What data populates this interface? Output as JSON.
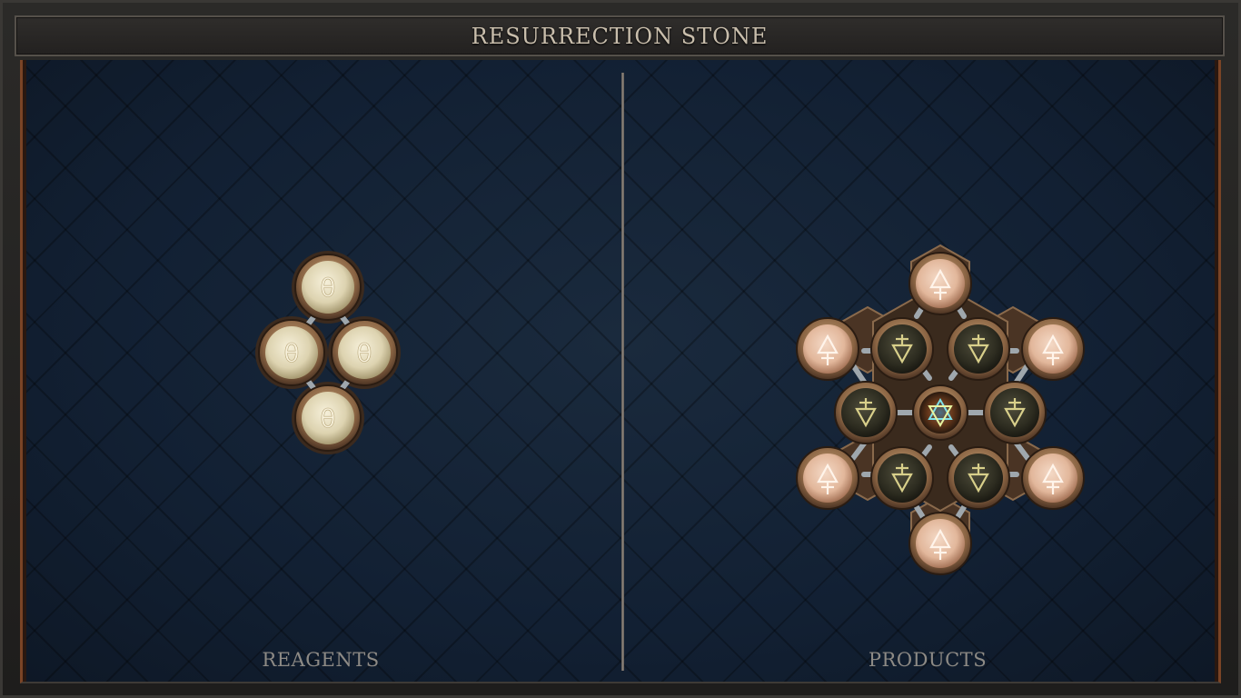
{
  "window": {
    "title": "RESURRECTION STONE"
  },
  "reagents": {
    "label": "REAGENTS",
    "node_symbol": "θ",
    "node_count": 4
  },
  "products": {
    "label": "PRODUCTS",
    "outer_symbol": "fire-elemental-rune",
    "inner_symbol": "earth-elemental-rune",
    "center_symbol": "hexagram-star",
    "outer_node_count": 6,
    "inner_node_count": 6,
    "center_node_count": 1
  },
  "colors": {
    "frame": "#2b2a28",
    "panel_background": "#142030",
    "accent_copper": "#7a4426",
    "title_text": "#c9beac",
    "label_text": "#8d8a85",
    "reagent_orb": "#e9e0c2",
    "product_outer_orb": "#e8c0a8",
    "product_inner_orb": "#3a3a2a"
  }
}
